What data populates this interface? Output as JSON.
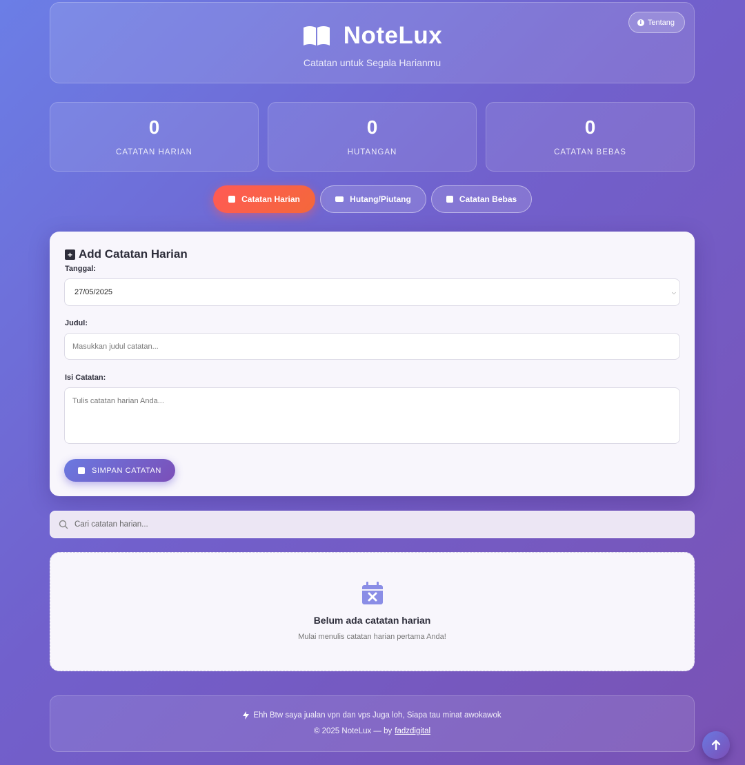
{
  "header": {
    "title": "NoteLux",
    "subtitle": "Catatan untuk Segala Harianmu",
    "about_label": "Tentang",
    "brand_icon": "book-open-icon"
  },
  "stats": [
    {
      "value": "0",
      "label": "CATATAN HARIAN"
    },
    {
      "value": "0",
      "label": "HUTANGAN"
    },
    {
      "value": "0",
      "label": "CATATAN BEBAS"
    }
  ],
  "tabs": [
    {
      "label": "Catatan Harian",
      "icon": "calendar-icon",
      "active": true
    },
    {
      "label": "Hutang/Piutang",
      "icon": "money-icon",
      "active": false
    },
    {
      "label": "Catatan Bebas",
      "icon": "sticky-note-icon",
      "active": false
    }
  ],
  "form": {
    "title": "Add Catatan Harian",
    "date_label": "Tanggal:",
    "date_value": "27/05/2025",
    "title_label": "Judul:",
    "title_placeholder": "Masukkan judul catatan...",
    "content_label": "Isi Catatan:",
    "content_placeholder": "Tulis catatan harian Anda...",
    "save_label": "SIMPAN CATATAN"
  },
  "search": {
    "placeholder": "Cari catatan harian..."
  },
  "empty_state": {
    "title": "Belum ada catatan harian",
    "subtitle": "Mulai menulis catatan harian pertama Anda!"
  },
  "footer": {
    "promo": "Ehh Btw saya jualan vpn dan vps Juga loh, Siapa tau minat awokawok",
    "copyright": "© 2025 NoteLux — by",
    "author": "fadzdigital"
  },
  "colors": {
    "accent": "#6a79e0",
    "active_tab": "#ff5a55",
    "background_start": "#6b7ee6",
    "background_end": "#7a52b4"
  }
}
